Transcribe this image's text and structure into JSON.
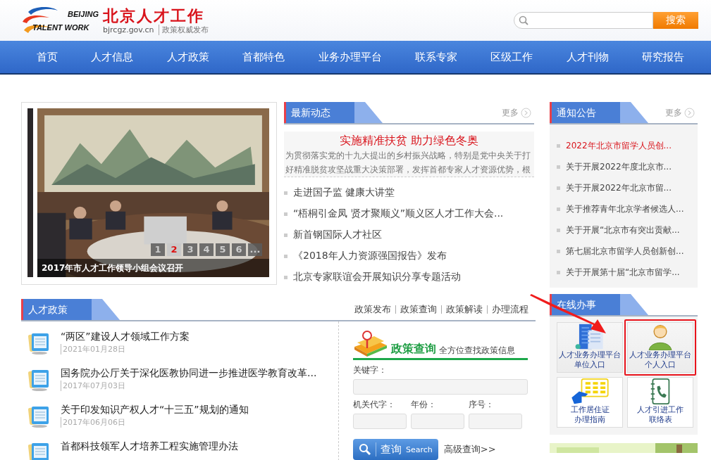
{
  "header": {
    "logo_top": "BEIJING",
    "logo_bottom": "TALENT WORK",
    "site_title": "北京人才工作",
    "domain": "bjrcgz.gov.cn",
    "slogan": "政策权威发布",
    "search_button": "搜索"
  },
  "nav": [
    "首页",
    "人才信息",
    "人才政策",
    "首都特色",
    "业务办理平台",
    "联系专家",
    "区级工作",
    "人才刊物",
    "研究报告"
  ],
  "carousel": {
    "caption": "2017年市人才工作领导小组会议召开",
    "more": "...",
    "pages": [
      {
        "label": "1",
        "selected": false
      },
      {
        "label": "2",
        "selected": true
      },
      {
        "label": "3",
        "selected": false
      },
      {
        "label": "4",
        "selected": false
      },
      {
        "label": "5",
        "selected": false
      },
      {
        "label": "6",
        "selected": false
      }
    ]
  },
  "news": {
    "title": "最新动态",
    "more": "更多",
    "headline": "实施精准扶贫 助力绿色冬奥",
    "summary": "为贯彻落实党的十九大提出的乡村振兴战略，特别是党中央关于打好精准脱贫攻坚战重大决策部署，发挥首都专家人才资源优势，根",
    "items": [
      "走进国子监  健康大讲堂",
      "“梧桐引金凤 贤才聚顺义”顺义区人才工作大会...",
      "新首钢国际人才社区",
      "《2018年人力资源强国报告》发布",
      "北京专家联谊会开展知识分享专题活动"
    ]
  },
  "notices": {
    "title": "通知公告",
    "more": "更多",
    "items": [
      {
        "text": "2022年北京市留学人员创...",
        "highlighted": true
      },
      {
        "text": "关于开展2022年度北京市...",
        "highlighted": false
      },
      {
        "text": "关于开展2022年北京市留...",
        "highlighted": false
      },
      {
        "text": "关于推荐青年北京学者候选人...",
        "highlighted": false
      },
      {
        "text": "关于开展“北京市有突出贡献...",
        "highlighted": false
      },
      {
        "text": "第七届北京市留学人员创新创...",
        "highlighted": false
      },
      {
        "text": "关于开展第十届“北京市留学...",
        "highlighted": false
      }
    ]
  },
  "policy": {
    "title": "人才政策",
    "links": [
      "政策发布",
      "政策查询",
      "政策解读",
      "办理流程"
    ],
    "items": [
      {
        "title": "“两区”建设人才领域工作方案",
        "date": "2021年01月28日"
      },
      {
        "title": "国务院办公厅关于深化医教协同进一步推进医学教育改革...",
        "date": "2017年07月03日"
      },
      {
        "title": "关于印发知识产权人才“十三五”规划的通知",
        "date": "2017年06月06日"
      },
      {
        "title": "首都科技领军人才培养工程实施管理办法"
      }
    ]
  },
  "policy_search": {
    "title": "政策查询",
    "subtitle": "全方位查找政策信息",
    "keyword_label": "关键字：",
    "code_label": "机关代字：",
    "year_label": "年份：",
    "serial_label": "序号：",
    "button": "查询",
    "button_sub": "Search",
    "advanced": "高级查询>>"
  },
  "services": {
    "title": "在线办事",
    "items": [
      {
        "kind": "building",
        "lines": [
          "人才业务办理平台",
          "单位入口"
        ],
        "highlighted": false
      },
      {
        "kind": "person",
        "lines": [
          "人才业务办理平台",
          "个人入口"
        ],
        "highlighted": true
      },
      {
        "kind": "hand",
        "lines": [
          "工作居住证",
          "办理指南"
        ],
        "highlighted": false
      },
      {
        "kind": "phonebook",
        "lines": [
          "人才引进工作",
          "联络表"
        ],
        "highlighted": false
      }
    ]
  }
}
